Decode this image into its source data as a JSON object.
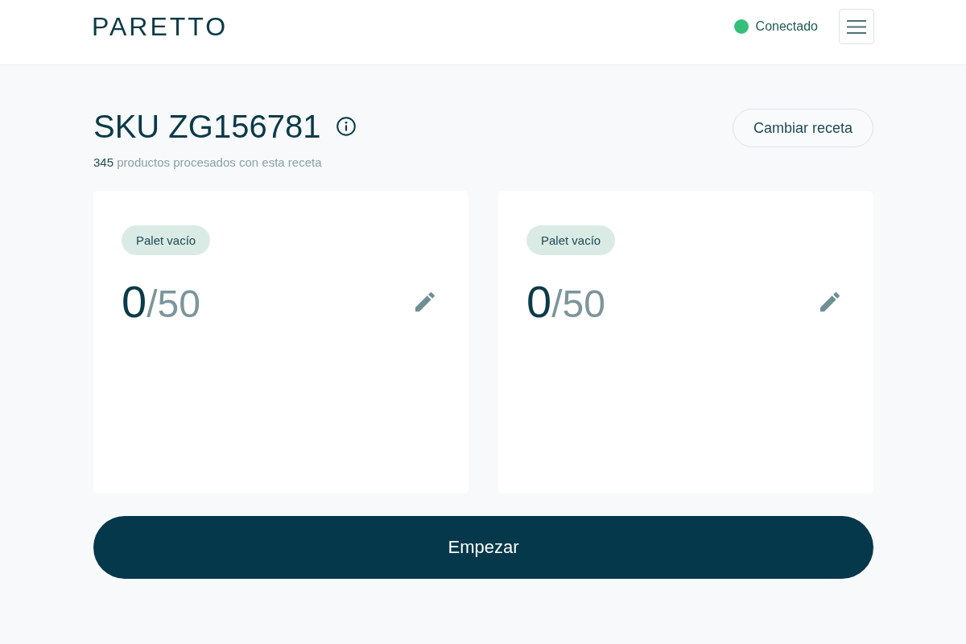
{
  "header": {
    "logo": "PARETTO",
    "status": {
      "label": "Conectado",
      "connected": true
    }
  },
  "recipe": {
    "title": "SKU ZG156781",
    "processed_count": "345",
    "processed_label": "productos procesados con esta receta",
    "change_button": "Cambiar receta"
  },
  "pallets": [
    {
      "badge": "Palet vacío",
      "count": "0",
      "capacity": "/50"
    },
    {
      "badge": "Palet vacío",
      "count": "0",
      "capacity": "/50"
    }
  ],
  "start_button": "Empezar"
}
